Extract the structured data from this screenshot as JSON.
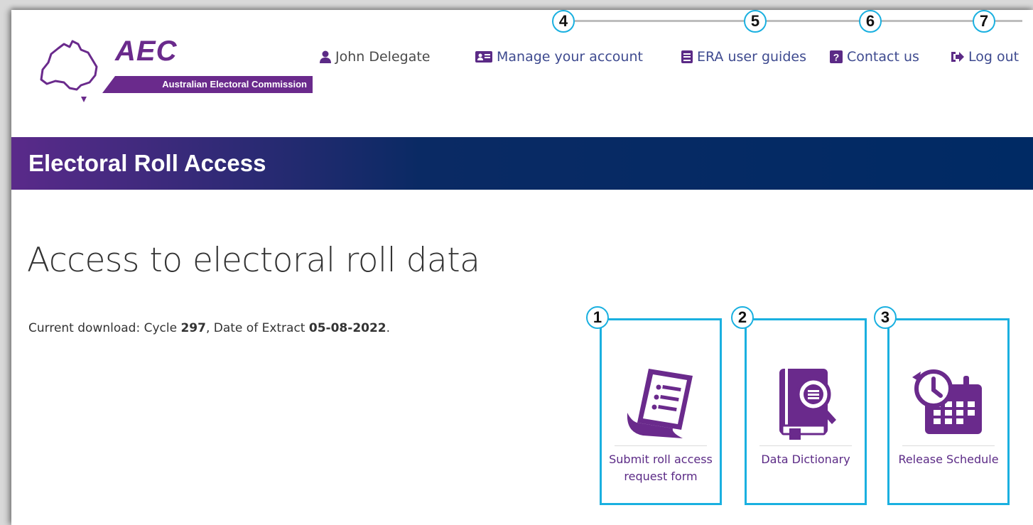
{
  "logo": {
    "abbrev": "AEC",
    "full_name": "Australian Electoral Commission",
    "brand_color": "#6a2a8c"
  },
  "nav": {
    "user": {
      "label": "John Delegate",
      "icon": "user-icon"
    },
    "items": [
      {
        "label": "Manage your account",
        "icon": "id-card-icon",
        "badge": "4"
      },
      {
        "label": "ERA user guides",
        "icon": "book-icon",
        "badge": "5"
      },
      {
        "label": "Contact us",
        "icon": "question-icon",
        "badge": "6"
      },
      {
        "label": "Log out",
        "icon": "sign-out-icon",
        "badge": "7"
      }
    ]
  },
  "banner": {
    "title": "Electoral Roll Access"
  },
  "main": {
    "title": "Access to electoral roll data",
    "download": {
      "prefix": "Current download: Cycle ",
      "cycle": "297",
      "middle": ", Date of Extract ",
      "date": "05-08-2022",
      "suffix": "."
    },
    "tiles": [
      {
        "label": "Submit roll access request form",
        "icon": "form-document-icon",
        "badge": "1"
      },
      {
        "label": "Data Dictionary",
        "icon": "book-search-icon",
        "badge": "2"
      },
      {
        "label": "Release Schedule",
        "icon": "calendar-clock-icon",
        "badge": "3"
      }
    ]
  },
  "colors": {
    "accent": "#1ab0e0",
    "link": "#3e4a8f",
    "banner": "#002a64",
    "tile_text": "#5b2a86"
  }
}
